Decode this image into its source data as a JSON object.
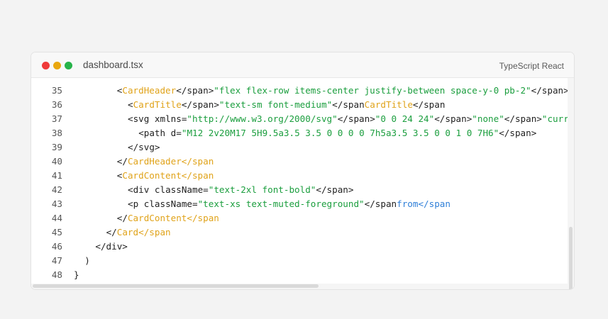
{
  "window": {
    "filename": "dashboard.tsx",
    "language": "TypeScript React"
  },
  "colors": {
    "tag": "#e0a31a",
    "string": "#1b9e3e",
    "keyword": "#2f7fd8",
    "text": "#222222",
    "traffic_red": "#ef3a3a",
    "traffic_yellow": "#e9a70f",
    "traffic_green": "#27b34a"
  },
  "code": {
    "lines": [
      {
        "num": "35",
        "indent": 8,
        "tokens": [
          {
            "t": "<",
            "c": "plain"
          },
          {
            "t": "CardHeader",
            "c": "tag"
          },
          {
            "t": "</span>",
            "c": "plain"
          },
          {
            "t": "\"flex flex-row items-center justify-between space-y-0 pb-2\"",
            "c": "str"
          },
          {
            "t": "</span>",
            "c": "plain"
          }
        ]
      },
      {
        "num": "36",
        "indent": 10,
        "tokens": [
          {
            "t": "<",
            "c": "plain"
          },
          {
            "t": "CardTitle",
            "c": "tag"
          },
          {
            "t": "</span>",
            "c": "plain"
          },
          {
            "t": "\"text-sm font-medium\"",
            "c": "str"
          },
          {
            "t": "</span",
            "c": "plain"
          },
          {
            "t": "CardTitle",
            "c": "tag"
          },
          {
            "t": "</span",
            "c": "plain"
          }
        ]
      },
      {
        "num": "37",
        "indent": 10,
        "tokens": [
          {
            "t": "<svg xmlns=",
            "c": "plain"
          },
          {
            "t": "\"http://www.w3.org/2000/svg\"",
            "c": "str"
          },
          {
            "t": "</span>",
            "c": "plain"
          },
          {
            "t": "\"0 0 24 24\"",
            "c": "str"
          },
          {
            "t": "</span>",
            "c": "plain"
          },
          {
            "t": "\"none\"",
            "c": "str"
          },
          {
            "t": "</span>",
            "c": "plain"
          },
          {
            "t": "\"current",
            "c": "str"
          }
        ]
      },
      {
        "num": "38",
        "indent": 12,
        "tokens": [
          {
            "t": "<path d=",
            "c": "plain"
          },
          {
            "t": "\"M12 2v20M17 5H9.5a3.5 3.5 0 0 0 0 7h5a3.5 3.5 0 0 1 0 7H6\"",
            "c": "str"
          },
          {
            "t": "</span>",
            "c": "plain"
          }
        ]
      },
      {
        "num": "39",
        "indent": 10,
        "tokens": [
          {
            "t": "</svg>",
            "c": "plain"
          }
        ]
      },
      {
        "num": "40",
        "indent": 8,
        "tokens": [
          {
            "t": "</",
            "c": "plain"
          },
          {
            "t": "CardHeader",
            "c": "tag"
          },
          {
            "t": "</span",
            "c": "tag"
          }
        ]
      },
      {
        "num": "41",
        "indent": 8,
        "tokens": [
          {
            "t": "<",
            "c": "plain"
          },
          {
            "t": "CardContent",
            "c": "tag"
          },
          {
            "t": "</span",
            "c": "tag"
          }
        ]
      },
      {
        "num": "42",
        "indent": 10,
        "tokens": [
          {
            "t": "<div className=",
            "c": "plain"
          },
          {
            "t": "\"text-2xl font-bold\"",
            "c": "str"
          },
          {
            "t": "</span>",
            "c": "plain"
          }
        ]
      },
      {
        "num": "43",
        "indent": 10,
        "tokens": [
          {
            "t": "<p className=",
            "c": "plain"
          },
          {
            "t": "\"text-xs text-muted-foreground\"",
            "c": "str"
          },
          {
            "t": "</span",
            "c": "plain"
          },
          {
            "t": "from",
            "c": "kw"
          },
          {
            "t": "</span",
            "c": "kw"
          }
        ]
      },
      {
        "num": "44",
        "indent": 8,
        "tokens": [
          {
            "t": "</",
            "c": "plain"
          },
          {
            "t": "CardContent",
            "c": "tag"
          },
          {
            "t": "</span",
            "c": "tag"
          }
        ]
      },
      {
        "num": "45",
        "indent": 6,
        "tokens": [
          {
            "t": "</",
            "c": "plain"
          },
          {
            "t": "Card",
            "c": "tag"
          },
          {
            "t": "</span",
            "c": "tag"
          }
        ]
      },
      {
        "num": "46",
        "indent": 4,
        "tokens": [
          {
            "t": "</div>",
            "c": "plain"
          }
        ]
      },
      {
        "num": "47",
        "indent": 2,
        "tokens": [
          {
            "t": ")",
            "c": "plain"
          }
        ]
      },
      {
        "num": "48",
        "indent": 0,
        "tokens": [
          {
            "t": "}",
            "c": "plain"
          }
        ]
      }
    ]
  }
}
